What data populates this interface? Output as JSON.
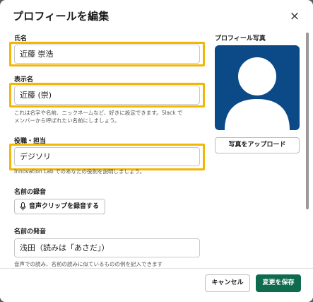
{
  "modal": {
    "title": "プロフィールを編集",
    "close_icon": "close-icon",
    "close_glyph": "×"
  },
  "fields": {
    "full_name": {
      "label": "氏名",
      "value": "近藤 崇浩"
    },
    "display_name": {
      "label": "表示名",
      "value": "近藤 (崇)",
      "help_line1": "これは名字や名前、ニックネームなど、好きに設定できます。Slack で",
      "help_line2": "メンバーから呼ばれたい名前にしましょう。"
    },
    "title_role": {
      "label": "役職・担当",
      "value": "デジソリ",
      "help": "Innovation Lab でのあなたの役割を説明しましょう。"
    },
    "name_recording": {
      "label": "名前の録音",
      "button": "音声クリップを録音する",
      "icon": "microphone-icon"
    },
    "name_pronunciation": {
      "label": "名前の発音",
      "value": "浅田（読みは「あさだ」）",
      "help": "音声での読み、名前の読みに似ているものの例を記入できます"
    }
  },
  "photo": {
    "label": "プロフィール写真",
    "upload_button": "写真をアップロード",
    "avatar_color": "#0b4a86"
  },
  "footer": {
    "cancel": "キャンセル",
    "save": "変更を保存"
  },
  "colors": {
    "highlight": "#f2b705",
    "primary": "#0f6b4e"
  }
}
